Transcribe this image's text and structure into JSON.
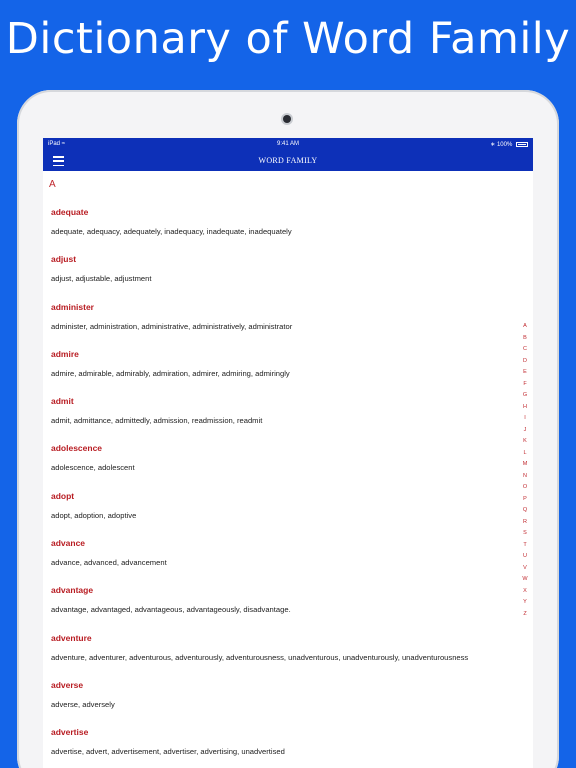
{
  "promo": {
    "title": "Dictionary of Word Family"
  },
  "statusbar": {
    "device": "iPad",
    "time": "9:41 AM",
    "battery": "100%"
  },
  "navbar": {
    "title": "WORD FAMILY"
  },
  "section": {
    "letter": "A"
  },
  "entries": [
    {
      "word": "adequate",
      "forms": "adequate, adequacy, adequately, inadequacy, inadequate, inadequately"
    },
    {
      "word": "adjust",
      "forms": "adjust, adjustable, adjustment"
    },
    {
      "word": "administer",
      "forms": "administer, administration, administrative, administratively, administrator"
    },
    {
      "word": "admire",
      "forms": "admire, admirable, admirably, admiration, admirer, admiring, admiringly"
    },
    {
      "word": "admit",
      "forms": "admit, admittance, admittedly, admission, readmission, readmit"
    },
    {
      "word": "adolescence",
      "forms": "adolescence, adolescent"
    },
    {
      "word": "adopt",
      "forms": "adopt, adoption, adoptive"
    },
    {
      "word": "advance",
      "forms": "advance, advanced, advancement"
    },
    {
      "word": "advantage",
      "forms": "advantage, advantaged, advantageous, advantageously, disadvantage."
    },
    {
      "word": "adventure",
      "forms": "adventure, adventurer, adventurous, adventurously, adventurousness, unadventurous, unadventurously, unadventurousness"
    },
    {
      "word": "adverse",
      "forms": "adverse, adversely"
    },
    {
      "word": "advertise",
      "forms": "advertise, advert, advertisement, advertiser, advertising, unadvertised"
    }
  ],
  "index_letters": [
    "A",
    "B",
    "C",
    "D",
    "E",
    "F",
    "G",
    "H",
    "I",
    "J",
    "K",
    "L",
    "M",
    "N",
    "O",
    "P",
    "Q",
    "R",
    "S",
    "T",
    "U",
    "V",
    "W",
    "X",
    "Y",
    "Z"
  ]
}
